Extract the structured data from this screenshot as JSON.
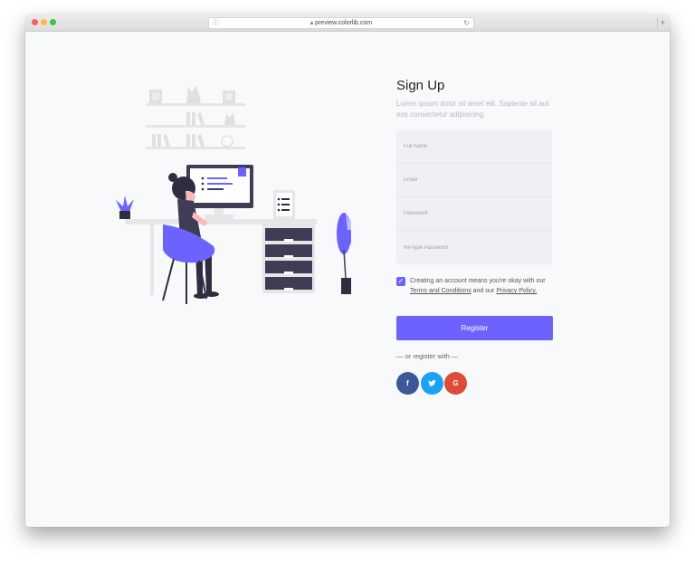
{
  "browser": {
    "url": "preview.colorlib.com",
    "new_tab_label": "+"
  },
  "form": {
    "title": "Sign Up",
    "subtitle": "Lorem ipsum dolor sit amet elit. Sapiente sit aut eos consectetur adipisicing.",
    "fields": [
      {
        "placeholder": "Full name",
        "value": ""
      },
      {
        "placeholder": "Email",
        "value": ""
      },
      {
        "placeholder": "Password",
        "value": ""
      },
      {
        "placeholder": "Re-type Password",
        "value": ""
      }
    ],
    "terms": {
      "checked": true,
      "prefix": "Creating an account means you're okay with our ",
      "terms_link": "Terms and Conditions",
      "middle": " and our ",
      "privacy_link": "Privacy Policy."
    },
    "register_label": "Register",
    "or_text": "— or register with —",
    "social": {
      "facebook_glyph": "f",
      "twitter_glyph": "t",
      "google_glyph": "G"
    }
  },
  "colors": {
    "accent": "#6c63ff",
    "facebook": "#3b5998",
    "twitter": "#1da1f2",
    "google": "#dd4b39"
  },
  "icons": [
    "lock-icon",
    "reload-icon",
    "check-icon",
    "facebook-icon",
    "twitter-icon",
    "google-icon"
  ]
}
